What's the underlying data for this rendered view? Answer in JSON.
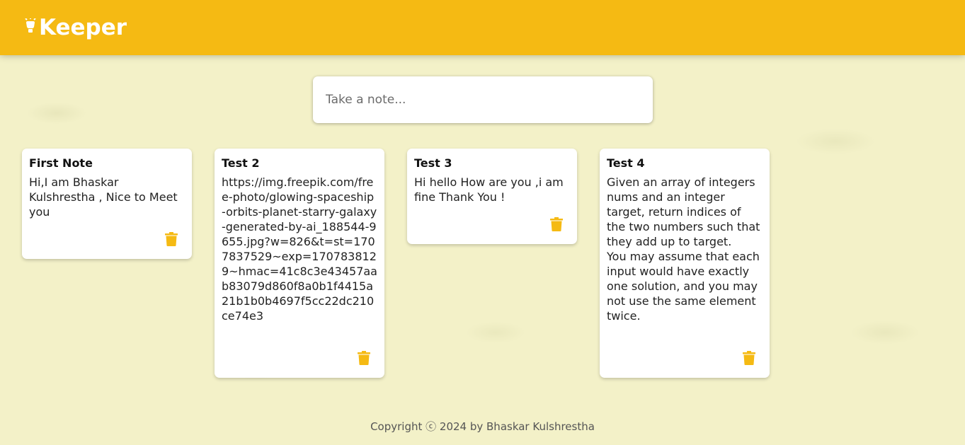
{
  "header": {
    "title": "Keeper",
    "icon": "lightbulb-icon",
    "color": "#f5ba13"
  },
  "create_note": {
    "placeholder": "Take a note..."
  },
  "notes": [
    {
      "title": "First Note",
      "content": "Hi,I am Bhaskar Kulshrestha , Nice to Meet you"
    },
    {
      "title": "Test 2",
      "content": "https://img.freepik.com/free-photo/glowing-spaceship-orbits-planet-starry-galaxy-generated-by-ai_188544-9655.jpg?w=826&t=st=1707837529~exp=1707838129~hmac=41c8c3e43457aab83079d860f8a0b1f4415a21b1b0b4697f5cc22dc210ce74e3"
    },
    {
      "title": "Test 3",
      "content": "Hi hello How are you ,i am fine Thank You !"
    },
    {
      "title": "Test 4",
      "content": "Given an array of integers nums and an integer target, return indices of the two numbers such that they add up to target.\nYou may assume that each input would have exactly one solution, and you may not use the same element twice."
    }
  ],
  "footer": {
    "text": "Copyright ⓒ 2024 by Bhaskar Kulshrestha"
  }
}
